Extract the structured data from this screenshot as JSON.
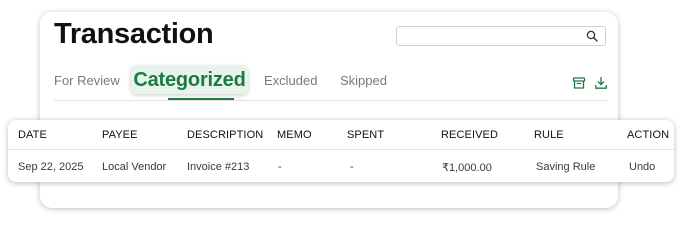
{
  "page": {
    "title": "Transaction"
  },
  "search": {
    "placeholder": "",
    "value": ""
  },
  "tabs": [
    {
      "label": "For Review",
      "active": false
    },
    {
      "label": "Categorized",
      "active": true
    },
    {
      "label": "Excluded",
      "active": false
    },
    {
      "label": "Skipped",
      "active": false
    }
  ],
  "toolbar": {
    "icons": [
      "archive-icon",
      "download-icon"
    ]
  },
  "colors": {
    "accent": "#1e7a45",
    "active_tab_bg": "#e6f4ec"
  },
  "table": {
    "columns": [
      "DATE",
      "PAYEE",
      "DESCRIPTION",
      "MEMO",
      "SPENT",
      "RECEIVED",
      "RULE",
      "ACTION"
    ],
    "rows": [
      {
        "date": "Sep 22, 2025",
        "payee": "Local Vendor",
        "description": "Invoice #213",
        "memo": "-",
        "spent": "-",
        "received": "₹1,000.00",
        "rule": "Saving Rule",
        "action": "Undo"
      }
    ]
  }
}
